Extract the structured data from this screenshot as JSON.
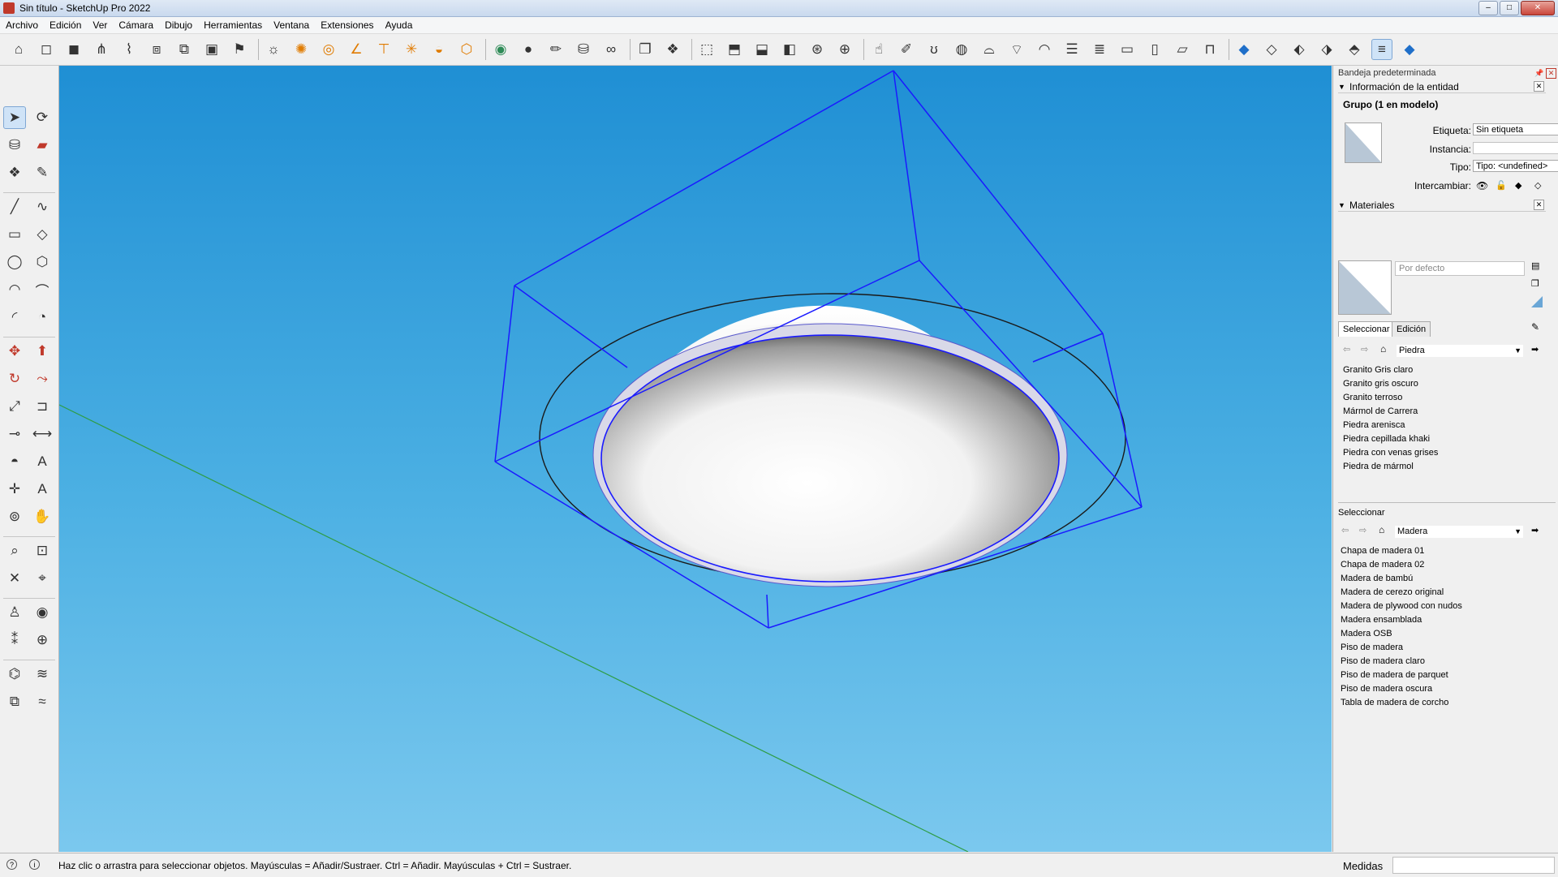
{
  "window": {
    "title": "Sin título - SketchUp Pro 2022",
    "controls": [
      "–",
      "□",
      "✕"
    ]
  },
  "menu": [
    "Archivo",
    "Edición",
    "Ver",
    "Cámara",
    "Dibujo",
    "Herramientas",
    "Ventana",
    "Extensiones",
    "Ayuda"
  ],
  "toolbar": {
    "icons": [
      "template-icon",
      "cube-icon",
      "cube-shaded-icon",
      "grass-icon",
      "wire-icon",
      "section-cube-icon",
      "section-plane-icon",
      "photo-icon",
      "camera-icon",
      "sun-icon",
      "gear-orange-icon",
      "circle-orange-icon",
      "angle-orange-icon",
      "table-orange-icon",
      "star-orange-icon",
      "dome-orange-icon",
      "box-orange-icon",
      "green-disc-icon",
      "coin-icon",
      "pencil-yellow-icon",
      "bucket-icon",
      "binoculars-icon",
      "stack-icon",
      "component-icon",
      "iso-icon",
      "top-view-icon",
      "front-view-icon",
      "right-view-icon",
      "back-view-icon",
      "left-view-icon",
      "hand-view-icon",
      "paint-icon",
      "swirl-icon",
      "shape-icon",
      "shape2-icon",
      "shape3-icon",
      "shape4-icon",
      "lines-icon",
      "wall-icon",
      "window-icon",
      "window2-icon",
      "window3-icon",
      "lock-icon",
      "gem-blue-icon",
      "gem-white-icon",
      "face-icon",
      "face2-icon",
      "face3-icon",
      "layers-icon",
      "gem-blue2-icon"
    ],
    "selected_index": 48
  },
  "tools": [
    "select-arrow-icon",
    "orbit-icon",
    "paint-bucket-icon",
    "eraser-icon",
    "component-tool-icon",
    "tag-pencil-icon",
    "line-icon",
    "freehand-icon",
    "rectangle-icon",
    "rotated-rectangle-icon",
    "circle-icon",
    "polygon-icon",
    "arc-icon",
    "arc2-icon",
    "arc3-icon",
    "pie-icon",
    "move-icon",
    "push-pull-icon",
    "rotate-icon",
    "follow-me-icon",
    "scale-icon",
    "offset-icon",
    "tape-measure-icon",
    "dimension-icon",
    "protractor-icon",
    "text-label-icon",
    "axes-icon",
    "3d-text-icon",
    "orbit2-icon",
    "pan-hand-icon",
    "zoom-icon",
    "zoom-window-icon",
    "zoom-extents-icon",
    "zoom-previous-icon",
    "walk-icon",
    "look-around-icon",
    "footprints-icon",
    "position-camera-icon",
    "sandbox-icon",
    "smoove-icon",
    "stamp-icon",
    "drape-icon"
  ],
  "tray": {
    "title": "Bandeja predeterminada",
    "entity_info": {
      "header": "Información de la entidad",
      "group": "Grupo (1 en modelo)",
      "tag_label": "Etiqueta:",
      "tag_value": "Sin etiqueta",
      "instance_label": "Instancia:",
      "instance_value": "",
      "type_label": "Tipo:",
      "type_value": "Tipo: <undefined>",
      "toggles_label": "Intercambiar:"
    },
    "materials": {
      "header": "Materiales",
      "name_placeholder": "Por defecto",
      "tab_select": "Seleccionar",
      "tab_edit": "Edición",
      "collection_1": "Piedra",
      "list_1": [
        "Granito Gris claro",
        "Granito gris oscuro",
        "Granito terroso",
        "Mármol de Carrera",
        "Piedra arenisca",
        "Piedra cepillada khaki",
        "Piedra con venas grises",
        "Piedra de mármol"
      ],
      "secondary_label": "Seleccionar",
      "collection_2": "Madera",
      "list_2": [
        "Chapa de madera 01",
        "Chapa de madera 02",
        "Madera de bambú",
        "Madera de cerezo original",
        "Madera de plywood con nudos",
        "Madera ensamblada",
        "Madera OSB",
        "Piso de madera",
        "Piso de madera claro",
        "Piso de madera de parquet",
        "Piso de madera oscura",
        "Tabla de madera de corcho"
      ]
    }
  },
  "status": {
    "message": "Haz clic o arrastra para seleccionar objetos. Mayúsculas = Añadir/Sustraer. Ctrl = Añadir. Mayúsculas + Ctrl = Sustraer.",
    "measurements_label": "Medidas",
    "measurements_value": ""
  },
  "colors": {
    "sky_top": "#1f8fd4",
    "sky_bottom": "#7bc8ee",
    "selection_blue": "#1a1aff",
    "green_axis": "#2e9d46"
  }
}
